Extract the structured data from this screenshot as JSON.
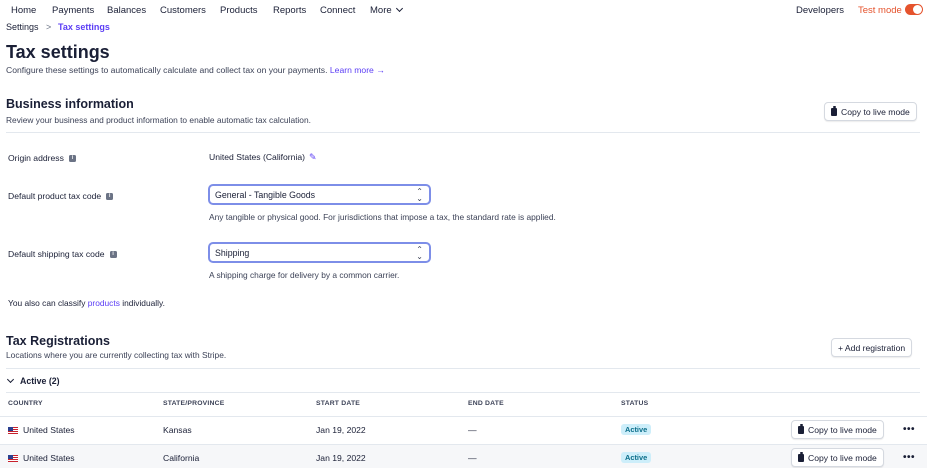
{
  "nav": {
    "items": [
      "Home",
      "Payments",
      "Balances",
      "Customers",
      "Products",
      "Reports",
      "Connect",
      "More"
    ],
    "developers": "Developers",
    "test_mode": "Test mode",
    "test_mode_on": true
  },
  "breadcrumb": {
    "parent": "Settings",
    "separator": ">",
    "current": "Tax settings"
  },
  "page": {
    "title": "Tax settings",
    "subtitle": "Configure these settings to automatically calculate and collect tax on your payments.",
    "learn_more": "Learn more →"
  },
  "business": {
    "title": "Business information",
    "description": "Review your business and product information to enable automatic tax calculation.",
    "copy_button": "Copy to live mode",
    "origin_label": "Origin address",
    "origin_value": "United States (California)",
    "product_label": "Default product tax code",
    "product_value": "General - Tangible Goods",
    "product_help": "Any tangible or physical good. For jurisdictions that impose a tax, the standard rate is applied.",
    "shipping_label": "Default shipping tax code",
    "shipping_value": "Shipping",
    "shipping_help": "A shipping charge for delivery by a common carrier.",
    "classify_prefix": "You also can classify",
    "classify_link": "products",
    "classify_suffix": "individually."
  },
  "registrations": {
    "title": "Tax Registrations",
    "description": "Locations where you are currently collecting tax with Stripe.",
    "add_button": "+ Add registration",
    "group_label": "Active (2)",
    "columns": [
      "COUNTRY",
      "STATE/PROVINCE",
      "START DATE",
      "END DATE",
      "STATUS"
    ],
    "rows": [
      {
        "country": "United States",
        "state": "Kansas",
        "start": "Jan 19, 2022",
        "end": "—",
        "status": "Active",
        "action": "Copy to live mode",
        "more": "•••"
      },
      {
        "country": "United States",
        "state": "California",
        "start": "Jan 19, 2022",
        "end": "—",
        "status": "Active",
        "action": "Copy to live mode",
        "more": "•••"
      }
    ]
  },
  "colors": {
    "accent": "#5b3df5",
    "test_mode": "#e5532d",
    "badge_bg": "#cdeefa",
    "badge_text": "#0a6e8a"
  }
}
